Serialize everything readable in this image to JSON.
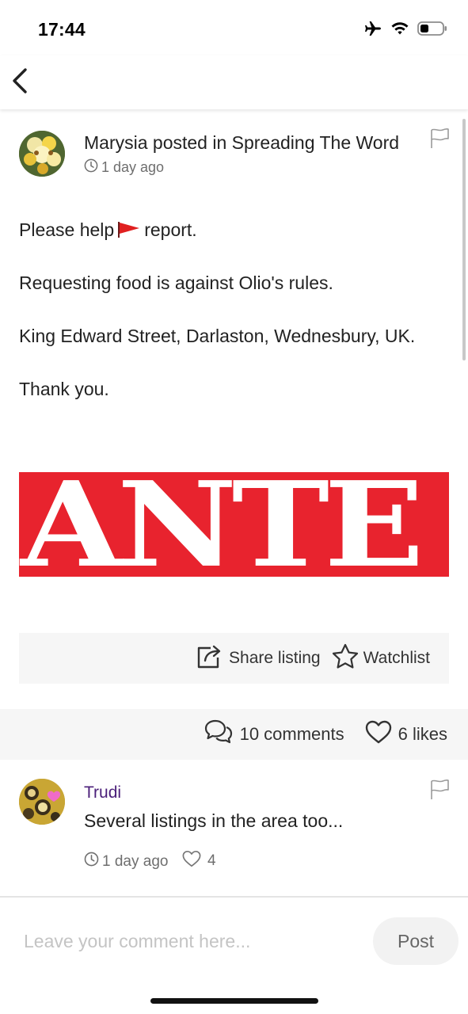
{
  "status_bar": {
    "time": "17:44",
    "icons": [
      "airplane-icon",
      "wifi-icon",
      "battery-icon"
    ]
  },
  "nav": {
    "back_icon": "chevron-left-icon"
  },
  "post": {
    "title": "Marysia posted in Spreading The Word",
    "time": "1 day ago",
    "body": {
      "line1_before": "Please help",
      "line1_after": "report.",
      "line2": "Requesting food is against Olio's rules.",
      "line3": "King Edward Street, Darlaston, Wednesbury, UK.",
      "line4": "Thank you."
    },
    "image_text": "ANTE"
  },
  "actions": {
    "share_label": "Share listing",
    "watchlist_label": "Watchlist"
  },
  "stats": {
    "comments_label": "10 comments",
    "likes_label": "6 likes"
  },
  "comment": {
    "author": "Trudi",
    "text": "Several listings in the area too...",
    "time": "1 day ago",
    "likes": "4"
  },
  "composer": {
    "placeholder": "Leave your comment here...",
    "post_label": "Post"
  },
  "colors": {
    "accent_purple": "#4b1f7a",
    "flag_red": "#e02020",
    "image_red": "#e8232e"
  }
}
